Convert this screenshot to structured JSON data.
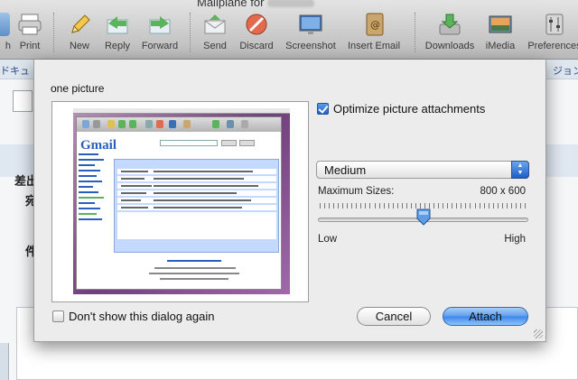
{
  "window": {
    "title": "Mailplane for",
    "toolbar": [
      {
        "label": "h",
        "icon": "refresh-icon"
      },
      {
        "label": "Print",
        "icon": "printer-icon"
      },
      {
        "label": "New",
        "icon": "pencil-icon"
      },
      {
        "label": "Reply",
        "icon": "reply-icon"
      },
      {
        "label": "Forward",
        "icon": "forward-icon"
      },
      {
        "label": "Send",
        "icon": "send-icon"
      },
      {
        "label": "Discard",
        "icon": "discard-icon"
      },
      {
        "label": "Screenshot",
        "icon": "screenshot-icon"
      },
      {
        "label": "Insert Email",
        "icon": "address-book-icon"
      },
      {
        "label": "Downloads",
        "icon": "downloads-icon"
      },
      {
        "label": "iMedia",
        "icon": "imedia-icon"
      },
      {
        "label": "Preferences",
        "icon": "preferences-icon"
      }
    ]
  },
  "background": {
    "tab_left": "ドキュ",
    "tab_right": "ジョン",
    "label_sender": "差出",
    "label_to": "宛",
    "label_subject": "件"
  },
  "dialog": {
    "title": "one picture",
    "optimize_label": "Optimize picture attachments",
    "optimize_checked": true,
    "size_option": "Medium",
    "max_sizes_label": "Maximum Sizes:",
    "max_sizes_value": "800 x 600",
    "slider_low": "Low",
    "slider_high": "High",
    "quality_level": 0.5,
    "dont_show_label": "Don't show this dialog again",
    "dont_show_checked": false,
    "cancel_label": "Cancel",
    "attach_label": "Attach",
    "preview_logo": "Gmail"
  },
  "colors": {
    "accent": "#3c86e8",
    "preview_bg": "#6f3f7a",
    "gmail_blue": "#2b5fbd"
  }
}
